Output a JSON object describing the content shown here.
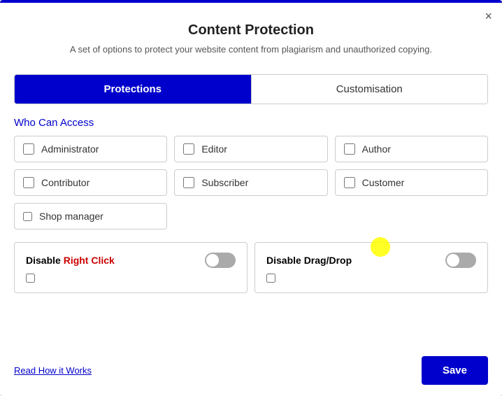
{
  "modal": {
    "title": "Content Protection",
    "subtitle": "A set of options to protect your website content from plagiarism and unauthorized copying.",
    "close_label": "×"
  },
  "tabs": [
    {
      "id": "protections",
      "label": "Protections",
      "active": true
    },
    {
      "id": "customisation",
      "label": "Customisation",
      "active": false
    }
  ],
  "section": {
    "who_can_access_label": "Who Can Access"
  },
  "checkboxes": [
    {
      "id": "administrator",
      "label": "Administrator",
      "checked": false
    },
    {
      "id": "editor",
      "label": "Editor",
      "checked": false
    },
    {
      "id": "author",
      "label": "Author",
      "checked": false
    },
    {
      "id": "contributor",
      "label": "Contributor",
      "checked": false
    },
    {
      "id": "subscriber",
      "label": "Subscriber",
      "checked": false
    },
    {
      "id": "customer",
      "label": "Customer",
      "checked": false
    },
    {
      "id": "shop-manager",
      "label": "Shop manager",
      "checked": false
    }
  ],
  "protection_cards": [
    {
      "id": "disable-right-click",
      "title_plain": "Disable ",
      "title_highlight": "Right Click",
      "toggle_on": false
    },
    {
      "id": "disable-drag-drop",
      "title_plain": "Disable Drag/Drop",
      "title_highlight": "",
      "toggle_on": false
    }
  ],
  "footer": {
    "read_link": "Read How it Works",
    "save_button": "Save"
  }
}
